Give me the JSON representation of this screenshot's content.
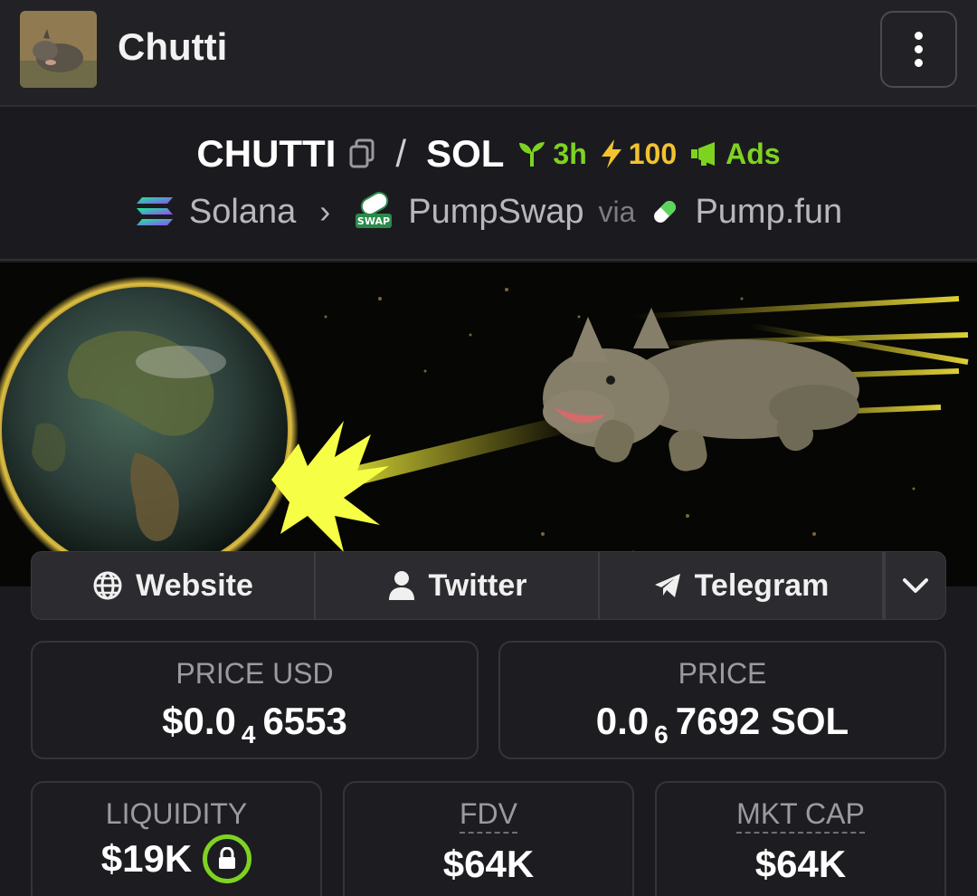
{
  "header": {
    "title": "Chutti",
    "avatar_icon": "rhino-avatar",
    "menu_icon": "kebab-menu-icon"
  },
  "pair": {
    "base": "CHUTTI",
    "separator": "/",
    "quote": "SOL",
    "age": "3h",
    "boost": "100",
    "ads": "Ads",
    "colors": {
      "age": "#7ed321",
      "boost": "#f2c230",
      "ads": "#7ed321"
    }
  },
  "chain": {
    "network": "Solana",
    "dex": "PumpSwap",
    "via_label": "via",
    "launchpad": "Pump.fun",
    "dex_icon_text": "SWAP"
  },
  "links": {
    "website": "Website",
    "twitter": "Twitter",
    "telegram": "Telegram"
  },
  "stats": {
    "price_usd_label": "PRICE USD",
    "price_usd_prefix": "$0.0",
    "price_usd_zeros": "4",
    "price_usd_digits": "6553",
    "price_label": "PRICE",
    "price_prefix": "0.0",
    "price_zeros": "6",
    "price_digits": "7692 SOL",
    "liquidity_label": "LIQUIDITY",
    "liquidity_value": "$19K",
    "fdv_label": "FDV",
    "fdv_value": "$64K",
    "mktcap_label": "MKT CAP",
    "mktcap_value": "$64K"
  }
}
